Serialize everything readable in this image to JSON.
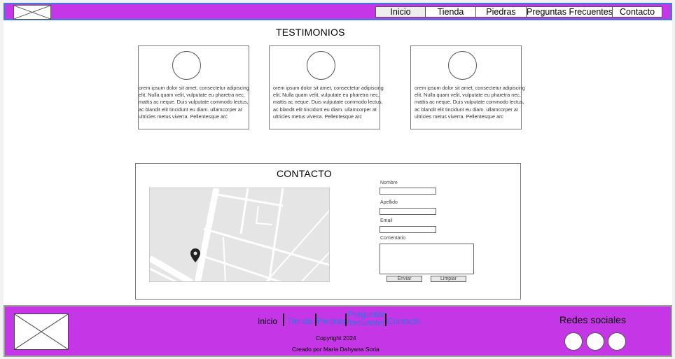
{
  "header": {
    "nav": [
      {
        "label": "Inicio"
      },
      {
        "label": "Tienda"
      },
      {
        "label": "Piedras"
      },
      {
        "label": "Preguntas Frecuentes"
      },
      {
        "label": "Contacto"
      }
    ]
  },
  "testimonials": {
    "title": "TESTIMONIOS",
    "items": [
      {
        "text": "orem ipsum dolor sit amet, consectetur adipiscing\nelit. Nulla quam velit, vulputate eu pharetra nec,\nmattis ac neque. Duis vulputate commodo lectus,\nac blandit elit tincidunt eu diam. ullamcorper at\nultricies metus viverra. Pellentesque arc"
      },
      {
        "text": "orem ipsum dolor sit amet, consectetur adipiscing\nelit. Nulla quam velit, vulputate eu pharetra nec,\nmattis ac neque. Duis vulputate commodo lectus,\nac blandit elit tincidunt eu diam. ullamcorper at\nultricies metus viverra. Pellentesque arc"
      },
      {
        "text": "orem ipsum dolor sit amet, consectetur adipiscing\nelit. Nulla quam velit, vulputate eu pharetra nec,\nmattis ac neque. Duis vulputate commodo lectus,\nac blandit elit tincidunt eu diam. ullamcorper at\nultricies metus viverra. Pellentesque arc"
      }
    ]
  },
  "contact": {
    "title": "CONTACTO",
    "form": {
      "nombre_label": "Nombre",
      "apellido_label": "Apellido",
      "email_label": "Email",
      "comentario_label": "Comentario",
      "send_label": "Enviar",
      "clear_label": "Limpiar"
    }
  },
  "footer": {
    "nav": {
      "inicio": "Inicio",
      "tienda": "Tienda",
      "piedras": "Piedras",
      "preguntas_line1": "Preguntas",
      "preguntas_line2": "frecuentes",
      "contacto": "Contacto"
    },
    "copyright": "Copyright 2024",
    "credit": "Creado por Maria Dahyana Soria",
    "social_title": "Redes sociales"
  },
  "colors": {
    "brand_purple": "#c537e6",
    "link_blue": "#2f73e0"
  },
  "icons": [
    "image-placeholder-icon",
    "map-pin-icon",
    "avatar-placeholder-icon",
    "social-icon"
  ]
}
